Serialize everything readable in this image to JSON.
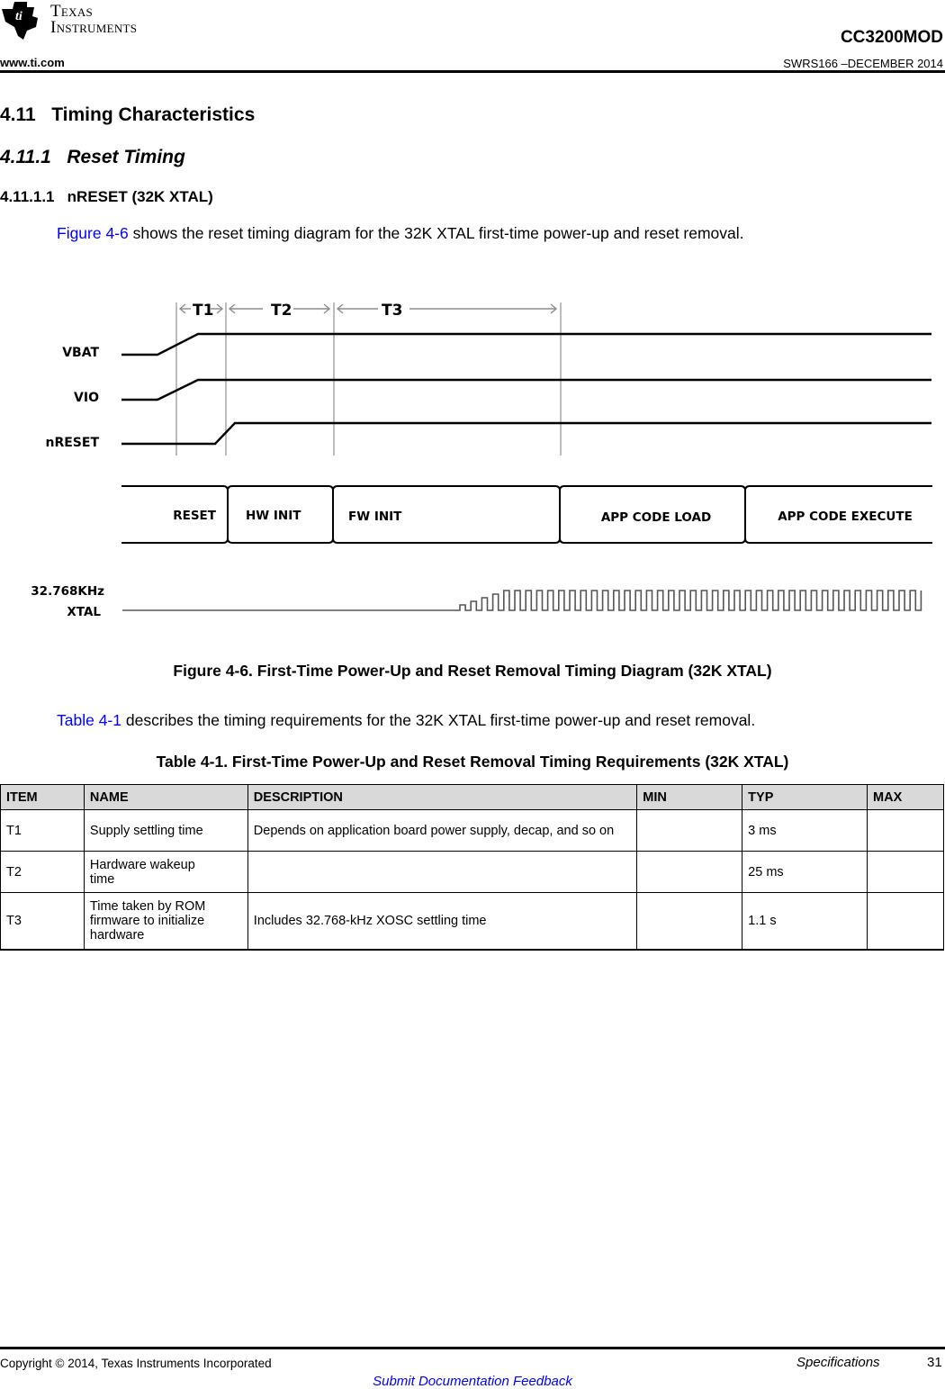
{
  "header": {
    "logo_line1": "Texas",
    "logo_line2": "Instruments",
    "document_id": "CC3200MOD",
    "website": "www.ti.com",
    "doc_number": "SWRS166 –DECEMBER 2014"
  },
  "headings": {
    "section": "4.11   Timing Characteristics",
    "subsection": "4.11.1   Reset Timing",
    "subsubsection": "4.11.1.1   nRESET (32K XTAL)"
  },
  "intro_paragraph": {
    "link": "Figure 4-6",
    "text": " shows the reset timing diagram for the 32K XTAL first-time power-up and reset removal."
  },
  "diagram": {
    "intervals": [
      "T1",
      "T2",
      "T3"
    ],
    "signals": [
      "VBAT",
      "VIO",
      "nRESET"
    ],
    "phases": [
      "RESET",
      "HW INIT",
      "FW INIT",
      "APP CODE LOAD",
      "APP CODE EXECUTE"
    ],
    "clock_label_line1": "32.768KHz",
    "clock_label_line2": "XTAL"
  },
  "figure_caption": "Figure 4-6. First-Time Power-Up and Reset Removal Timing Diagram (32K XTAL)",
  "table_paragraph": {
    "link": "Table 4-1",
    "text": " describes the timing requirements for the 32K XTAL first-time power-up and reset removal."
  },
  "table": {
    "caption": "Table 4-1. First-Time Power-Up and Reset Removal Timing Requirements (32K XTAL)",
    "headers": [
      "ITEM",
      "NAME",
      "DESCRIPTION",
      "MIN",
      "TYP",
      "MAX"
    ],
    "rows": [
      [
        "T1",
        "Supply settling time",
        "Depends on application board power supply, decap, and so on",
        "",
        "3 ms",
        ""
      ],
      [
        "T2",
        "Hardware wakeup time",
        "",
        "",
        "25 ms",
        ""
      ],
      [
        "T3",
        "Time taken by ROM firmware to initialize hardware",
        "Includes 32.768-kHz XOSC settling time",
        "",
        "1.1 s",
        ""
      ]
    ]
  },
  "footer": {
    "copyright": "Copyright © 2014, Texas Instruments Incorporated",
    "section_name": "Specifications",
    "page_number": "31",
    "feedback_link": "Submit Documentation Feedback"
  },
  "colors": {
    "link": "#0000ff",
    "table_header_bg": "#d9d9d9",
    "guide_line": "#a6a6a6"
  }
}
